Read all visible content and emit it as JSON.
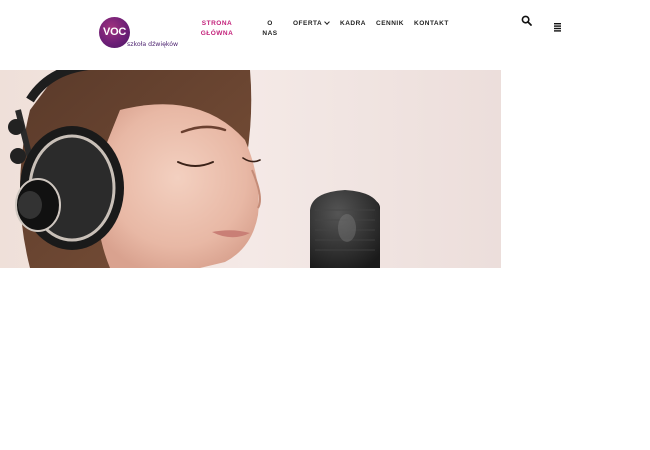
{
  "logo": {
    "mark": "VOC",
    "tagline": "szkoła dźwięków"
  },
  "nav": {
    "items": [
      {
        "label_line1": "STRONA",
        "label_line2": "GŁÓWNA",
        "active": true
      },
      {
        "label_line1": "O",
        "label_line2": "NAS",
        "active": false
      },
      {
        "label_line1": "OFERTA",
        "has_dropdown": true,
        "active": false
      },
      {
        "label_line1": "KADRA",
        "active": false
      },
      {
        "label_line1": "CENNIK",
        "active": false
      },
      {
        "label_line1": "KONTAKT",
        "active": false
      }
    ],
    "active_color": "#c3217a"
  },
  "header_icons": [
    "search-icon",
    "menu-icon"
  ],
  "hero": {
    "image": "woman-with-headphones-singing-into-microphone"
  },
  "colors": {
    "brand_purple": "#6e1f77",
    "accent_pink": "#c3217a"
  }
}
